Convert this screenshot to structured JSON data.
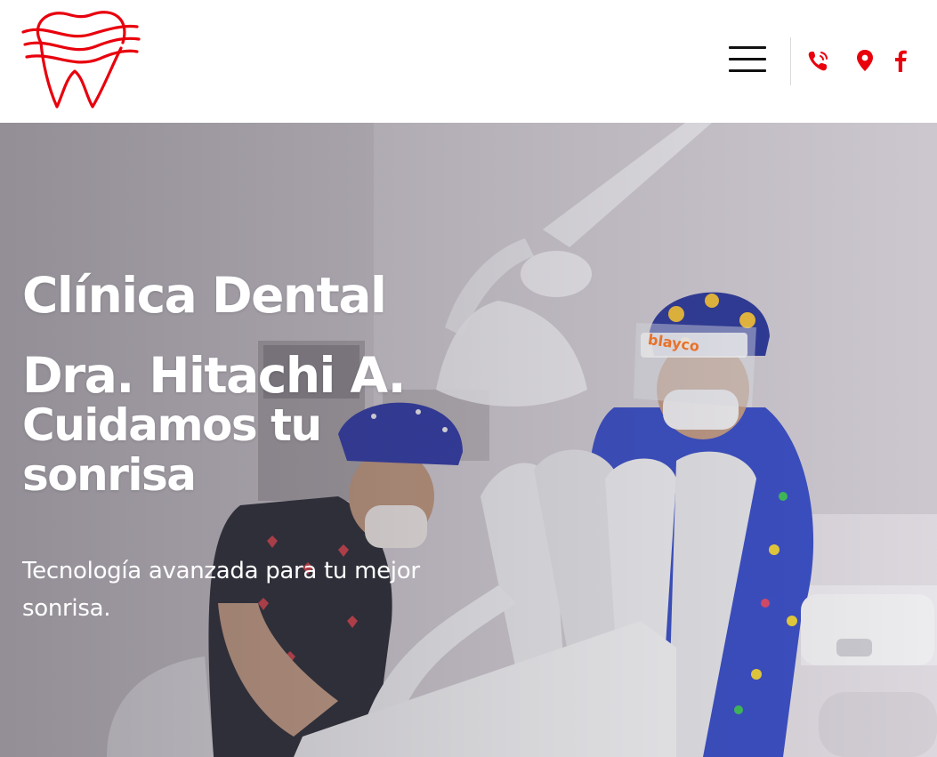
{
  "header": {
    "logo_icon": "tooth-logo-icon",
    "menu_icon": "hamburger-menu-icon",
    "icons": [
      {
        "name": "phone-icon",
        "color": "#e8000d"
      },
      {
        "name": "map-pin-icon",
        "color": "#e8000d"
      },
      {
        "name": "facebook-icon",
        "color": "#e8000d"
      }
    ]
  },
  "hero": {
    "title_line1": "Clínica Dental",
    "title_line2": "Dra. Hitachi A.",
    "title_line3": "Cuidamos tu sonrisa",
    "subtitle": "Tecnología avanzada para tu mejor sonrisa.",
    "visor_brand": "blayco"
  },
  "colors": {
    "accent": "#e8000d",
    "header_bg": "#ffffff",
    "hero_text": "#ffffff"
  }
}
